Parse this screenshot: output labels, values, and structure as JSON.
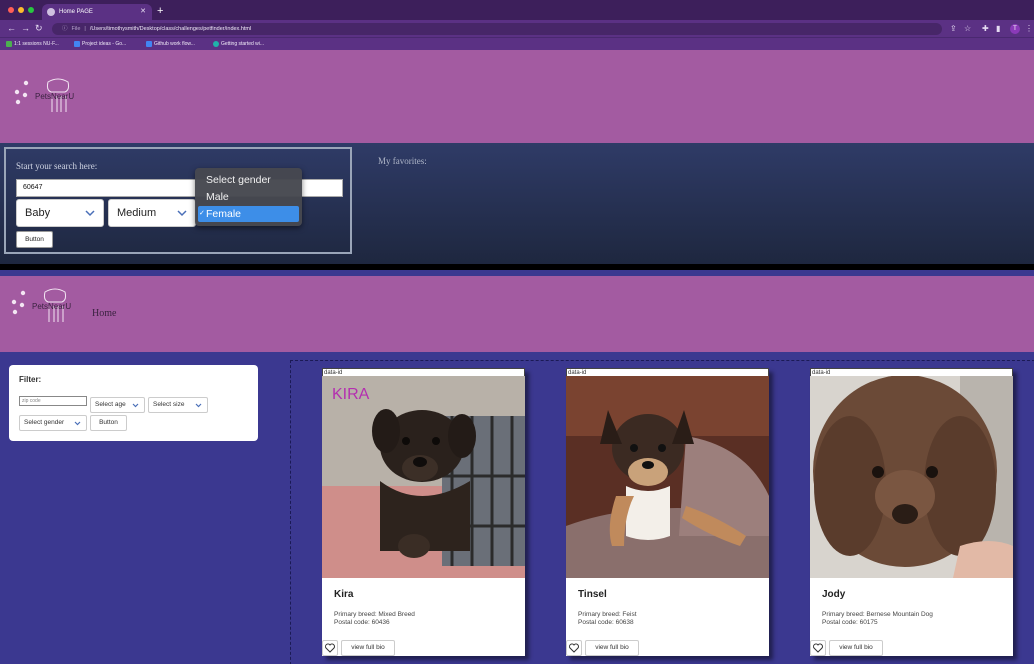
{
  "browser": {
    "tab_title": "Home PAGE",
    "url_prefix": "File",
    "url": "/Users/timothysmith/Desktop/class/challenges/petfinder/index.html",
    "profile_initial": "T",
    "bookmarks": [
      "1:1 sessions NU-F...",
      "Project ideas - Go...",
      "Github work flow...",
      "Getting started wi..."
    ]
  },
  "site1": {
    "logo_text": "PetsNearU",
    "search_label": "Start your search here:",
    "zip_value": "60647",
    "age_selected": "Baby",
    "size_selected": "Medium",
    "button_label": "Button",
    "favorites_label": "My favorites:",
    "gender_dropdown": {
      "options": [
        "Select gender",
        "Male",
        "Female"
      ],
      "selected": "Female",
      "check": "✓"
    }
  },
  "site2": {
    "logo_text": "PetsNearU",
    "nav_home": "Home",
    "filter": {
      "title": "Filter:",
      "zip_placeholder": "zip code",
      "age": "Select age",
      "size": "Select size",
      "gender": "Select gender",
      "button": "Button"
    },
    "pets": [
      {
        "data_id": "data-id",
        "name": "Kira",
        "photo_label": "KIRA",
        "breed": "Primary breed: Mixed Breed",
        "postal": "Postal code: 60436",
        "bio_button": "view full bio"
      },
      {
        "data_id": "data-id",
        "name": "Tinsel",
        "breed": "Primary breed: Feist",
        "postal": "Postal code: 60638",
        "bio_button": "view full bio"
      },
      {
        "data_id": "data-id",
        "name": "Jody",
        "breed": "Primary breed: Bernese Mountain Dog",
        "postal": "Postal code: 60175",
        "bio_button": "view full bio"
      }
    ]
  },
  "colors": {
    "header_purple": "#a35ba1",
    "page_indigo": "#3b3890",
    "chrome_purple": "#5b3184",
    "dropdown_highlight": "#3d8ee8"
  }
}
